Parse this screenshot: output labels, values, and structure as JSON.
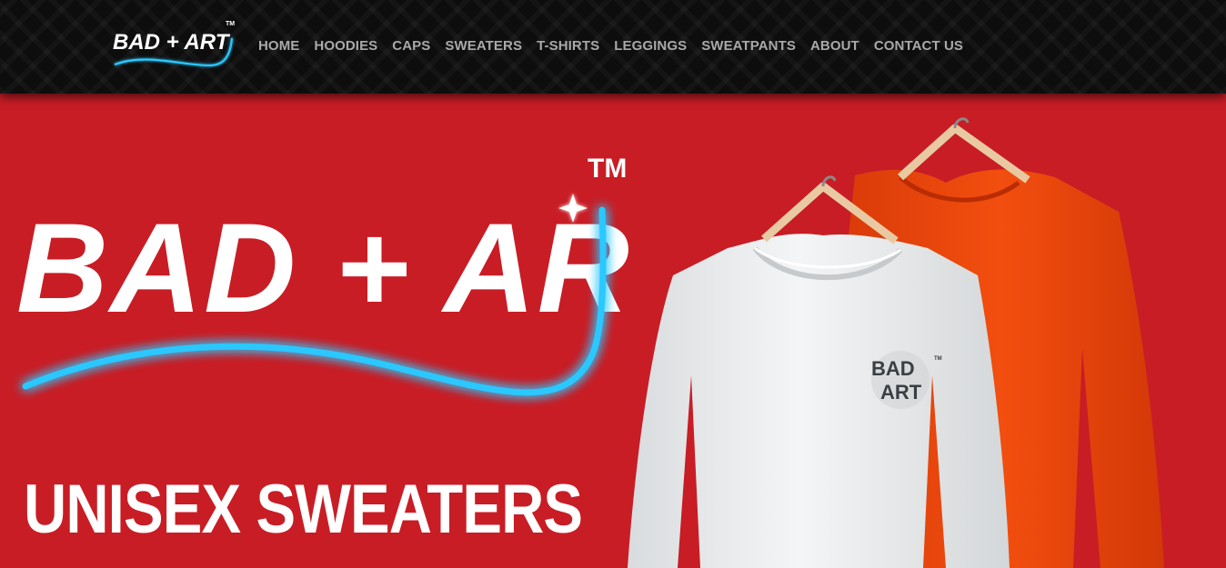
{
  "brand": {
    "name": "BAD + ART",
    "trademark": "TM"
  },
  "nav": {
    "items": [
      {
        "label": "HOME"
      },
      {
        "label": "HOODIES"
      },
      {
        "label": "CAPS"
      },
      {
        "label": "SWEATERS"
      },
      {
        "label": "T-SHIRTS"
      },
      {
        "label": "LEGGINGS"
      },
      {
        "label": "SWEATPANTS"
      },
      {
        "label": "ABOUT"
      },
      {
        "label": "CONTACT US"
      }
    ]
  },
  "hero": {
    "headline": "UNISEX SWEATERS",
    "logo_text": "BAD + ART",
    "trademark": "TM",
    "sweater_badge": {
      "line1": "BAD",
      "line2": "ART",
      "trademark": "TM"
    }
  },
  "colors": {
    "header_bg": "#0d0d0d",
    "hero_bg": "#c81d25",
    "nav_text": "#a9a9a9",
    "neon_blue": "#29c8ff",
    "white_sweater": "#eceeef",
    "orange_sweater": "#f04a0d",
    "hanger": "#e9c9a2"
  }
}
